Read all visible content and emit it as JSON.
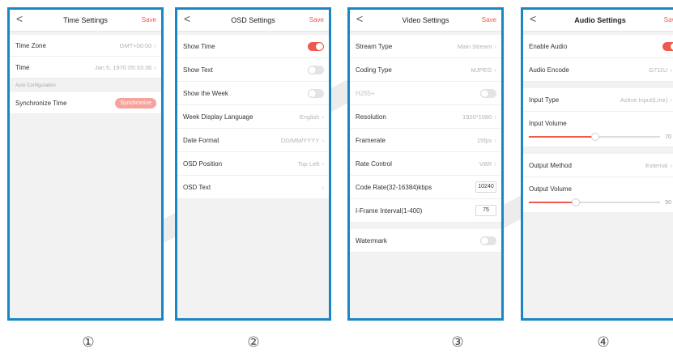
{
  "screens": [
    {
      "header": {
        "back": "<",
        "title": "Time Settings",
        "save": "Save"
      },
      "rows": [
        {
          "label": "Time Zone",
          "value": "GMT+00:00"
        },
        {
          "label": "Time",
          "value": "Jan 5, 1970 05:33:36"
        }
      ],
      "section_caption": "Auto Configuration",
      "sync": {
        "label": "Synchronize Time",
        "button": "Synchronize"
      },
      "marker": "①"
    },
    {
      "header": {
        "back": "<",
        "title": "OSD Settings",
        "save": "Save"
      },
      "rows": [
        {
          "label": "Show Time",
          "toggle": true
        },
        {
          "label": "Show Text",
          "toggle": false
        },
        {
          "label": "Show the Week",
          "toggle": false
        },
        {
          "label": "Week Display Language",
          "value": "English"
        },
        {
          "label": "Date Format",
          "value": "DD/MM/YYYY"
        },
        {
          "label": "OSD Position",
          "value": "Top Left"
        },
        {
          "label": "OSD Text",
          "value": ""
        }
      ],
      "marker": "②"
    },
    {
      "header": {
        "back": "<",
        "title": "Video Settings",
        "save": "Save"
      },
      "rows": [
        {
          "label": "Stream Type",
          "value": "Main Stream"
        },
        {
          "label": "Coding Type",
          "value": "MJPEG"
        },
        {
          "label": "H265+",
          "toggle": false
        },
        {
          "label": "Resolution",
          "value": "1920*1080"
        },
        {
          "label": "Framerate",
          "value": "15fps"
        },
        {
          "label": "Rate Control",
          "value": "VBR"
        },
        {
          "label": "Code Rate(32-16384)kbps",
          "input": "10240"
        },
        {
          "label": "I-Frame Interval(1-400)",
          "input": "75"
        }
      ],
      "watermark": {
        "label": "Watermark",
        "toggle": false
      },
      "marker": "③"
    },
    {
      "header": {
        "back": "<",
        "title": "Audio Settings",
        "save": "Save"
      },
      "rows": [
        {
          "label": "Enable Audio",
          "toggle": true
        },
        {
          "label": "Audio Encode",
          "value": "G711U"
        }
      ],
      "input_type": {
        "label": "Input Type",
        "value": "Active Input(Line)"
      },
      "input_volume": {
        "label": "Input Volume",
        "value": 70,
        "max": 100,
        "display": "70"
      },
      "output_method": {
        "label": "Output Method",
        "value": "External"
      },
      "output_volume": {
        "label": "Output Volume",
        "value": 50,
        "max": 100,
        "display": "50"
      },
      "marker": "④"
    }
  ],
  "colors": {
    "accent": "#f0594d",
    "frame": "#1a86c4",
    "background": "#f2f2f2"
  },
  "icons": {
    "back": "chevron-left-icon",
    "row_arrow": "chevron-right-icon"
  }
}
